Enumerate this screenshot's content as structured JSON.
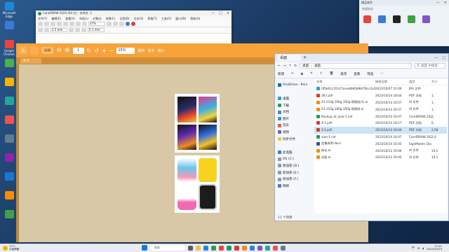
{
  "desktop": {
    "icons": [
      {
        "label": "Microsoft Edge",
        "color": "#1e88d8"
      },
      {
        "label": "",
        "color": "#3a7bd5"
      },
      {
        "label": "Google Chrome",
        "color": "#e8453c"
      },
      {
        "label": "",
        "color": "#4caf50"
      },
      {
        "label": "",
        "color": "#f4b400"
      },
      {
        "label": "",
        "color": "#26a69a"
      },
      {
        "label": "",
        "color": "#ef5350"
      },
      {
        "label": "",
        "color": "#607d8b"
      },
      {
        "label": "",
        "color": "#8e24aa"
      },
      {
        "label": "",
        "color": "#1976d2"
      },
      {
        "label": "",
        "color": "#fb8c00"
      },
      {
        "label": "",
        "color": "#43a047"
      }
    ]
  },
  "corel": {
    "title": "CorelDRAW 2020 (64 位) - 未命名 -1",
    "menu": [
      "文件(F)",
      "编辑(E)",
      "查看(V)",
      "布局(L)",
      "对象(J)",
      "效果(C)",
      "位图(B)",
      "文本(X)",
      "表格(T)",
      "工具(O)",
      "窗口(W)",
      "帮助(H)"
    ],
    "zoom": "37%",
    "width": "2.5 mm",
    "stroke": "0.1 mm"
  },
  "viewer": {
    "back_label": "上一页",
    "next_label": "下一页",
    "page": "1",
    "zoom": "25%",
    "actions": [
      "旋转",
      "放大",
      "缩小"
    ],
    "tab": "X-2"
  },
  "explorer": {
    "tab": "桌面",
    "new_label": "新建",
    "address": [
      "桌面",
      "桌面"
    ],
    "search_placeholder": "在 桌面 中搜索",
    "commands": [
      "排序",
      "查看",
      "筛选"
    ],
    "nav": [
      {
        "label": "OneDrive - Pers",
        "color": "#0f6cbd"
      },
      {
        "label": "",
        "color": "#fff"
      },
      {
        "label": "桌面",
        "color": "#2f9bd8"
      },
      {
        "label": "下载",
        "color": "#2aa34a"
      },
      {
        "label": "文档",
        "color": "#4c83c9"
      },
      {
        "label": "图片",
        "color": "#2f9bd8"
      },
      {
        "label": "音乐",
        "color": "#e85c41"
      },
      {
        "label": "视频",
        "color": "#7a5ac2"
      },
      {
        "label": "同步文件",
        "color": "#f2c24e"
      },
      {
        "label": "",
        "color": "#fff"
      },
      {
        "label": "此电脑",
        "color": "#3a7bd5"
      },
      {
        "label": "OS (C:)",
        "color": "#8a9bb0"
      },
      {
        "label": "新加卷 (D:)",
        "color": "#8a9bb0"
      },
      {
        "label": "新加卷 (E:)",
        "color": "#8a9bb0"
      },
      {
        "label": "新加卷 (F:)",
        "color": "#8a9bb0"
      },
      {
        "label": "网络",
        "color": "#3a7bd5"
      }
    ],
    "columns": [
      "名称",
      "修改日期",
      "类型",
      "大小"
    ],
    "files": [
      {
        "name": "0f5b61c1f1d73cee8b60b9bf78cc2a5fe6d",
        "date": "2023/10/07 10:49",
        "type": "JPG 文件",
        "size": "",
        "color": "#2f9bd8"
      },
      {
        "name": "367.pdf",
        "date": "2023/10/14 18:04",
        "type": "PDF 文档",
        "size": "1,",
        "color": "#d9392e"
      },
      {
        "name": "A3 210g 300g 350g 铜版纸(1).ai",
        "date": "2023/10/14 16:57",
        "type": "AI 文件",
        "size": "1,",
        "color": "#f28c1e"
      },
      {
        "name": "A3 210g 300g 350g 铜版纸.ai",
        "date": "2023/10/14 16:57",
        "type": "AI 文件",
        "size": "1,",
        "color": "#f28c1e"
      },
      {
        "name": "Backup_of_xiao-1.cdr",
        "date": "2023/10/14 16:47",
        "type": "CorelDRAW 2020",
        "size": "2,",
        "color": "#1f9d55"
      },
      {
        "name": "X-1.pdf",
        "date": "2023/10/14 18:17",
        "type": "PDF 文档",
        "size": "6,",
        "color": "#d9392e"
      },
      {
        "name": "X-2.pdf",
        "date": "2023/10/14 18:04",
        "type": "PDF 文档",
        "size": "2,58",
        "color": "#d9392e"
      },
      {
        "name": "xiao-1.cdr",
        "date": "2023/10/14 16:47",
        "type": "CorelDRAW 2020",
        "size": "2,0",
        "color": "#1f9d55"
      },
      {
        "name": "定稿说明.docx",
        "date": "2023/10/14 16:45",
        "type": "SignMaster Docu",
        "size": "",
        "color": "#2b5797"
      },
      {
        "name": "结论.ai",
        "date": "2023/10/12 19:46",
        "type": "AI 文件",
        "size": "10,5",
        "color": "#f28c1e"
      },
      {
        "name": "封面.ai",
        "date": "2023/10/12 19:45",
        "type": "AI 文件",
        "size": "10,1",
        "color": "#f28c1e"
      }
    ],
    "status": "11 个项目"
  },
  "rightpanel": {
    "title": "精品软件",
    "subtitle": "快速启动"
  },
  "taskbar": {
    "weather": "12°C",
    "weather_sub": "大部晴朗",
    "search_placeholder": "搜索",
    "time": "17:01",
    "date": "2023/10/19",
    "lang": "中"
  }
}
